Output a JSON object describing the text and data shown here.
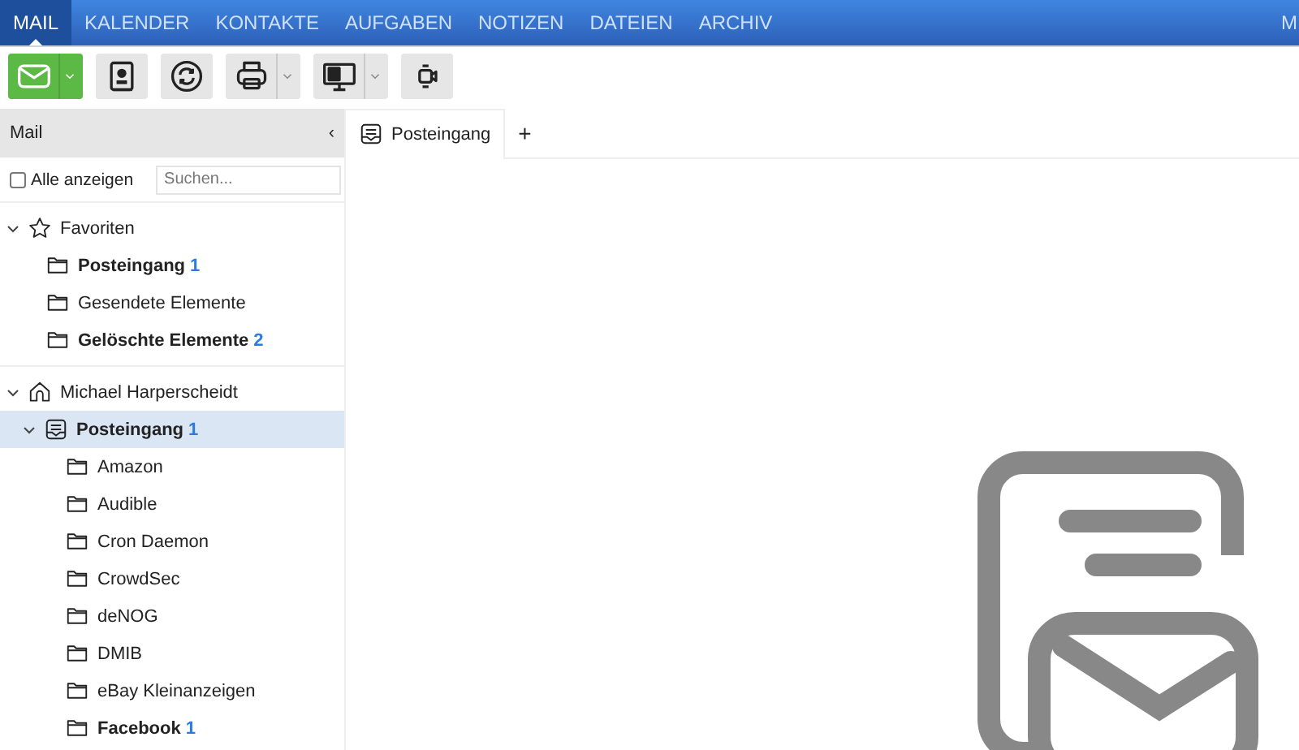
{
  "nav": {
    "items": [
      {
        "label": "MAIL",
        "selected": true
      },
      {
        "label": "KALENDER",
        "selected": false
      },
      {
        "label": "KONTAKTE",
        "selected": false
      },
      {
        "label": "AUFGABEN",
        "selected": false
      },
      {
        "label": "NOTIZEN",
        "selected": false
      },
      {
        "label": "DATEIEN",
        "selected": false
      },
      {
        "label": "ARCHIV",
        "selected": false
      }
    ],
    "edge_text": "M"
  },
  "toolbar": [
    {
      "kind": "mail",
      "primary": true,
      "dropdown": true
    },
    {
      "kind": "contacts",
      "primary": false,
      "dropdown": false
    },
    {
      "kind": "sync",
      "primary": false,
      "dropdown": false
    },
    {
      "kind": "print",
      "primary": false,
      "dropdown": true
    },
    {
      "kind": "display",
      "primary": false,
      "dropdown": true
    },
    {
      "kind": "video",
      "primary": false,
      "dropdown": false
    }
  ],
  "sidebar": {
    "title": "Mail",
    "collapse_glyph": "‹",
    "show_all": {
      "label": "Alle anzeigen",
      "checked": false
    },
    "search": {
      "placeholder": "Suchen..."
    },
    "sections": [
      {
        "label": "Favoriten",
        "kind": "star",
        "expanded": true,
        "items": [
          {
            "label": "Posteingang",
            "count": "1",
            "kind": "folder",
            "selected": false
          },
          {
            "label": "Gesendete Elemente",
            "kind": "folder",
            "selected": false
          },
          {
            "label": "Gelöschte Elemente",
            "count": "2",
            "kind": "folder",
            "selected": false
          }
        ]
      },
      {
        "label": "Michael Harperscheidt",
        "kind": "home",
        "expanded": true,
        "items": [
          {
            "label": "Posteingang",
            "count": "1",
            "kind": "inbox",
            "selected": true,
            "expanded": true,
            "children": [
              {
                "label": "Amazon",
                "kind": "folder",
                "selected": false
              },
              {
                "label": "Audible",
                "kind": "folder",
                "selected": false
              },
              {
                "label": "Cron Daemon",
                "kind": "folder",
                "selected": false
              },
              {
                "label": "CrowdSec",
                "kind": "folder",
                "selected": false
              },
              {
                "label": "deNOG",
                "kind": "folder",
                "selected": false
              },
              {
                "label": "DMIB",
                "kind": "folder",
                "selected": false
              },
              {
                "label": "eBay Kleinanzeigen",
                "kind": "folder",
                "selected": false
              },
              {
                "label": "Facebook",
                "count": "1",
                "kind": "folder",
                "selected": false
              }
            ]
          }
        ]
      }
    ]
  },
  "tabs": [
    {
      "label": "Posteingang",
      "kind": "inbox",
      "selected": true
    }
  ],
  "add_tab": "+"
}
